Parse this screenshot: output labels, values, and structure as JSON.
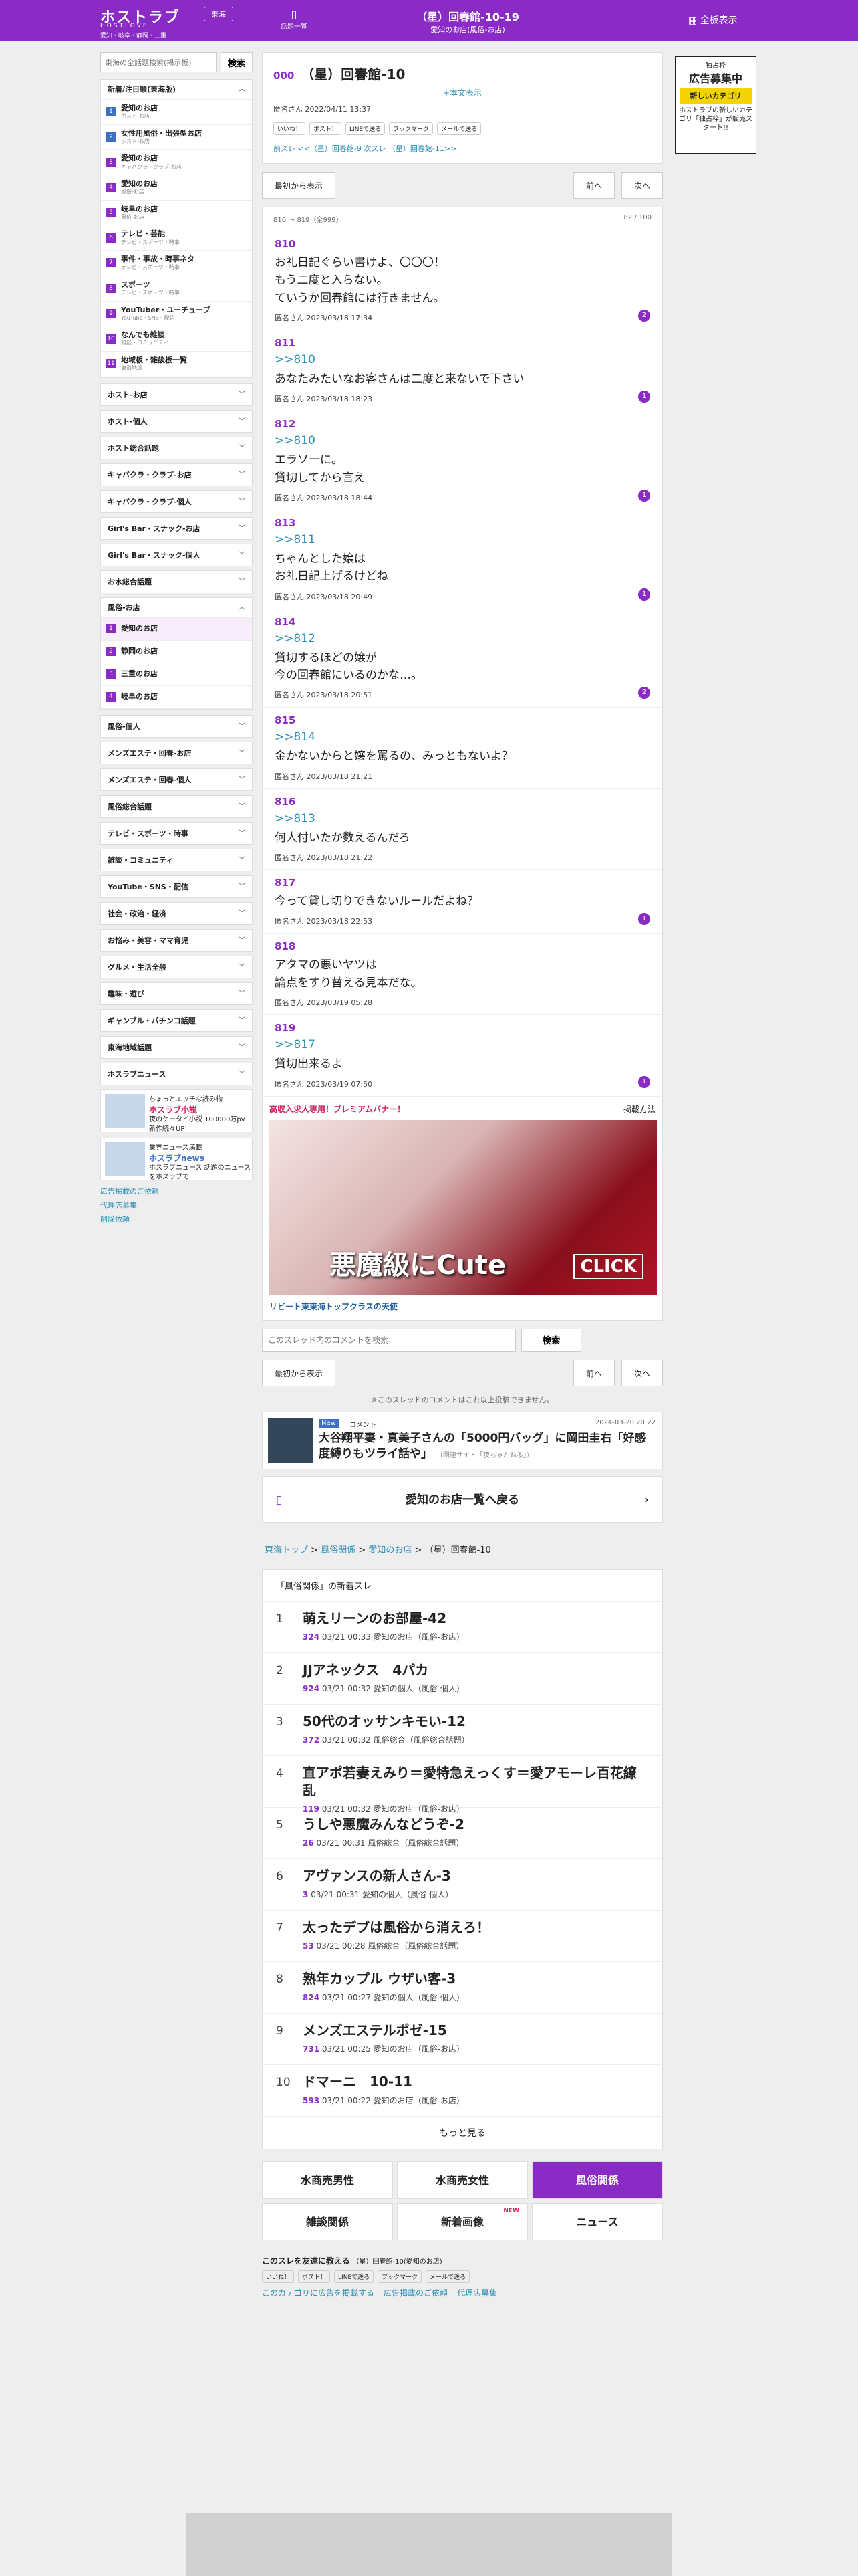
{
  "header": {
    "logo": "ホストラブ",
    "logo_sub": "HOSTLOVE",
    "area": "愛知・岐阜・静岡・三重",
    "region": "東海",
    "list_label": "話題一覧",
    "title": "（星）回春館-10-19",
    "subtitle": "愛知のお店(風俗-お店)",
    "all": "全板表示"
  },
  "ad_right": {
    "top": "独占枠",
    "big": "広告募集中",
    "yellow": "新しいカテゴリ",
    "text": "ホストラブの新しいカテゴリ「独占枠」が販売スタート!!"
  },
  "sidebar": {
    "search_placeholder": "東海の全話題検索(掲示板)",
    "search_btn": "検索",
    "group1": {
      "head": "新着/注目順(東海版)",
      "items": [
        {
          "n": "1",
          "label": "愛知のお店",
          "note": "ホスト-お店"
        },
        {
          "n": "2",
          "label": "女性用風俗・出張型お店",
          "note": "ホスト-お店"
        },
        {
          "n": "3",
          "label": "愛知のお店",
          "note": "キャバクラ・クラブ-お店"
        },
        {
          "n": "4",
          "label": "愛知のお店",
          "note": "風俗-お店"
        },
        {
          "n": "5",
          "label": "岐阜のお店",
          "note": "風俗-お店"
        },
        {
          "n": "6",
          "label": "テレビ・芸能",
          "note": "テレビ・スポーツ・時事"
        },
        {
          "n": "7",
          "label": "事件・事故・時事ネタ",
          "note": "テレビ・スポーツ・時事"
        },
        {
          "n": "8",
          "label": "スポーツ",
          "note": "テレビ・スポーツ・時事"
        },
        {
          "n": "9",
          "label": "YouTuber・ユーチューブ",
          "note": "YouTube・SNS・配信"
        },
        {
          "n": "10",
          "label": "なんでも雑談",
          "note": "雑談・コミュニティ"
        },
        {
          "n": "11",
          "label": "地域板・雑談板一覧",
          "note": "東海地域"
        }
      ]
    },
    "cats_a": [
      "ホスト-お店",
      "ホスト-個人",
      "ホスト総合話題",
      "キャバクラ・クラブ-お店",
      "キャバクラ・クラブ-個人",
      "Girl's Bar・スナック-お店",
      "Girl's Bar・スナック-個人",
      "お水総合話題"
    ],
    "fuzoku": {
      "head": "風俗-お店",
      "items": [
        {
          "n": "1",
          "label": "愛知のお店"
        },
        {
          "n": "2",
          "label": "静岡のお店"
        },
        {
          "n": "3",
          "label": "三重のお店"
        },
        {
          "n": "4",
          "label": "岐阜のお店"
        }
      ]
    },
    "cats_b": [
      "風俗-個人",
      "メンズエステ・回春-お店",
      "メンズエステ・回春-個人",
      "風俗総合話題",
      "テレビ・スポーツ・時事",
      "雑談・コミュニティ",
      "YouTube・SNS・配信",
      "社会・政治・経済",
      "お悩み・美容・ママ育児",
      "グルメ・生活全般",
      "趣味・遊び",
      "ギャンブル・パチンコ話題",
      "東海地域話題",
      "ホスラブニュース"
    ],
    "banner1": {
      "line1": "ちょっとエッチな読み物",
      "line2": "ホスラブ小説",
      "line3": "夜のケータイ小説 100000万pv 新作続々UP!"
    },
    "banner2": {
      "line1": "業界ニュース満載",
      "line2": "ホスラブnews",
      "line3": "ホスラブニュース 話題のニュースをホスラブで"
    },
    "links": [
      "広告掲載のご依頼",
      "代理店募集",
      "削除依頼"
    ]
  },
  "thread": {
    "no": "000",
    "title": "（星）回春館-10",
    "honbun": "+本文表示",
    "meta": "匿名さん 2022/04/11 13:37",
    "share": [
      "いいね！",
      "ポスト！",
      "LINEで送る",
      "ブックマーク",
      "メールで送る"
    ],
    "prevnext": "前スレ <<（星）回春館-9 次スレ （星）回春館-11>>"
  },
  "nav": {
    "first": "最初から表示",
    "prev": "前へ",
    "next": "次へ"
  },
  "range": {
    "left": "810 〜 819（全999）",
    "right": "82 / 100"
  },
  "posts": [
    {
      "no": "810",
      "anchor": "",
      "body": "お礼日記ぐらい書けよ、〇〇〇！\nもう二度と入らない。\nていうか回春館には行きません。",
      "meta": "匿名さん 2023/03/18 17:34",
      "badge": "2"
    },
    {
      "no": "811",
      "anchor": ">>810",
      "body": "あなたみたいなお客さんは二度と来ないで下さい",
      "meta": "匿名さん 2023/03/18 18:23",
      "badge": "1"
    },
    {
      "no": "812",
      "anchor": ">>810",
      "body": "エラソーに。\n貸切してから言え",
      "meta": "匿名さん 2023/03/18 18:44",
      "badge": "1"
    },
    {
      "no": "813",
      "anchor": ">>811",
      "body": "ちゃんとした嬢は\nお礼日記上げるけどね",
      "meta": "匿名さん 2023/03/18 20:49",
      "badge": "1"
    },
    {
      "no": "814",
      "anchor": ">>812",
      "body": "貸切するほどの嬢が\n今の回春館にいるのかな…。",
      "meta": "匿名さん 2023/03/18 20:51",
      "badge": "2"
    },
    {
      "no": "815",
      "anchor": ">>814",
      "body": "金かないからと嬢を罵るの、みっともないよ？",
      "meta": "匿名さん 2023/03/18 21:21",
      "badge": ""
    },
    {
      "no": "816",
      "anchor": ">>813",
      "body": "何人付いたか数えるんだろ",
      "meta": "匿名さん 2023/03/18 21:22",
      "badge": ""
    },
    {
      "no": "817",
      "anchor": "",
      "body": "今って貸し切りできないルールだよね？",
      "meta": "匿名さん 2023/03/18 22:53",
      "badge": "1"
    },
    {
      "no": "818",
      "anchor": "",
      "body": "アタマの悪いヤツは\n論点をすり替える見本だな。",
      "meta": "匿名さん 2023/03/19 05:28",
      "badge": ""
    },
    {
      "no": "819",
      "anchor": ">>817",
      "body": "貸切出来るよ",
      "meta": "匿名さん 2023/03/19 07:50",
      "badge": "1"
    }
  ],
  "premium": {
    "title": "高収入求人専用！プレミアムバナー！",
    "howto": "掲載方法",
    "big": "悪魔級にCute",
    "click": "CLICK",
    "caption": "リビート東東海トップクラスの天使"
  },
  "comment_search": {
    "placeholder": "このスレッド内のコメントを検索",
    "btn": "検索"
  },
  "nocomment": "※このスレッドのコメントはこれ以上投稿できません。",
  "news": {
    "tag": "New",
    "comment": "コメント！",
    "date": "2024-03-20 20:22",
    "title": "大谷翔平妻・真美子さんの「5000円バッグ」に岡田圭右「好感度縛りもツライ話や」",
    "source": "（関連サイト「夜ちゃんねる」）"
  },
  "back": "愛知のお店一覧へ戻る",
  "breadcrumb": {
    "a": "東海トップ",
    "b": "風俗関係",
    "c": "愛知のお店",
    "d": "（星）回春館-10"
  },
  "new_threads": {
    "head": "「風俗関係」の新着スレ",
    "items": [
      {
        "n": "1",
        "t": "萌えリーンのお部屋-42",
        "c": "324",
        "m": "03/21 00:33 愛知のお店（風俗-お店）"
      },
      {
        "n": "2",
        "t": "JJアネックス　4パカ",
        "c": "924",
        "m": "03/21 00:32 愛知の個人（風俗-個人）"
      },
      {
        "n": "3",
        "t": "50代のオッサンキモい-12",
        "c": "372",
        "m": "03/21 00:32 風俗総合（風俗総合話題）"
      },
      {
        "n": "4",
        "t": "直アポ若妻えみり＝愛特急えっくす＝愛アモーレ百花繚乱",
        "c": "119",
        "m": "03/21 00:32 愛知のお店（風俗-お店）"
      },
      {
        "n": "5",
        "t": "うしや悪魔みんなどうぞ-2",
        "c": "26",
        "m": "03/21 00:31 風俗総合（風俗総合話題）"
      },
      {
        "n": "6",
        "t": "アヴァンスの新人さん-3",
        "c": "3",
        "m": "03/21 00:31 愛知の個人（風俗-個人）"
      },
      {
        "n": "7",
        "t": "太ったデブは風俗から消えろ！",
        "c": "53",
        "m": "03/21 00:28 風俗総合（風俗総合話題）"
      },
      {
        "n": "8",
        "t": "熟年カップル ウザい客-3",
        "c": "824",
        "m": "03/21 00:27 愛知の個人（風俗-個人）"
      },
      {
        "n": "9",
        "t": "メンズエステルポゼ-15",
        "c": "731",
        "m": "03/21 00:25 愛知のお店（風俗-お店）"
      },
      {
        "n": "10",
        "t": "ドマーニ　10-11",
        "c": "593",
        "m": "03/21 00:22 愛知のお店（風俗-お店）"
      }
    ],
    "more": "もっと見る"
  },
  "cats": [
    {
      "label": "水商売男性",
      "active": false
    },
    {
      "label": "水商売女性",
      "active": false
    },
    {
      "label": "風俗関係",
      "active": true
    },
    {
      "label": "雑談関係",
      "active": false
    },
    {
      "label": "新着画像",
      "active": false,
      "new": "NEW"
    },
    {
      "label": "ニュース",
      "active": false
    }
  ],
  "bottom": {
    "share_label": "このスレを友達に教える",
    "share_target": "（星）回春館-10(愛知のお店)",
    "share": [
      "いいね！",
      "ポスト！",
      "LINEで送る",
      "ブックマーク",
      "メールで送る"
    ],
    "links": [
      "このカテゴリに広告を掲載する",
      "広告掲載のご依頼",
      "代理店募集"
    ]
  }
}
